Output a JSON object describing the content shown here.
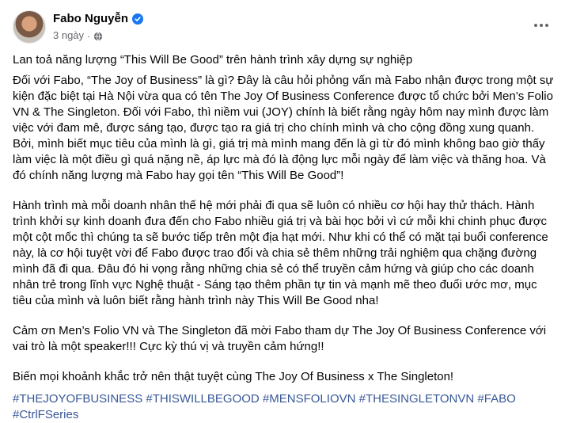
{
  "post": {
    "author": "Fabo Nguyễn",
    "timestamp": "3 ngày",
    "separator": "·",
    "paragraphs": {
      "p1": "Lan toả năng lượng “This Will Be Good” trên hành trình xây dựng sự nghiệp",
      "p2": "Đối với Fabo, “The Joy of Business” là gì? Đây là câu hỏi phỏng vấn mà Fabo nhận được trong một sự kiện đặc biệt tại Hà Nội vừa qua có tên The Joy Of Business Conference được tổ chức bởi Men’s Folio VN & The Singleton. Đối với Fabo, thì niềm vui (JOY) chính là biết rằng ngày hôm nay mình được làm việc với đam mê, được sáng tạo, được tạo ra giá trị cho chính mình và cho cộng đồng xung quanh. Bởi, mình biết mục tiêu của mình là gì, giá trị mà mình mang đến là gì từ đó mình không bao giờ thấy làm việc là một điều gì quá nặng nề, áp lực mà đó là động lực mỗi ngày để làm việc và thăng hoa. Và đó chính năng lượng mà Fabo hay gọi tên “This Will Be Good”!",
      "p3": "Hành trình mà mỗi doanh nhân thế hệ mới phải đi qua sẽ luôn có nhiều cơ hội hay thử thách. Hành trình khởi sự kinh doanh đưa đến cho Fabo nhiều giá trị và bài học bởi vì cứ mỗi khi chinh phục được một cột mốc thì chúng ta sẽ bước tiếp trên một địa hạt mới. Như khi có thể có mặt tại buổi conference này, là cơ hội tuyệt vời để Fabo được trao đổi và chia sẻ thêm những trải nghiệm qua chặng đường mình đã đi qua. Đâu đó hi vọng rằng những chia sẻ có thể truyền cảm hứng và giúp cho các doanh nhân trẻ trong lĩnh vực Nghệ thuật - Sáng tạo thêm phần tự tin và mạnh mẽ theo đuổi ước mơ, mục tiêu của mình và luôn biết rằng hành trình này This Will Be Good nha!",
      "p4": "Cảm ơn Men’s Folio VN và The Singleton đã mời Fabo tham dự The Joy Of Business Conference với vai trò là một speaker!!! Cực kỳ thú vị và truyền cảm hứng!!",
      "p5": "Biến mọi khoảnh khắc trở nên thật tuyệt cùng The Joy Of Business x The Singleton!"
    },
    "hashtags": [
      "#THEJOYOFBUSINESS",
      "#THISWILLBEGOOD",
      "#MENSFOLIOVN",
      "#THESINGLETONVN",
      "#FABO",
      "#CtrlFSeries"
    ],
    "colors": {
      "text": "#050505",
      "secondary": "#65676b",
      "link": "#385898",
      "verified": "#1877f2"
    },
    "icons": {
      "verified": "verified-badge-icon",
      "privacy": "globe-icon",
      "menu": "more-options-icon"
    }
  }
}
